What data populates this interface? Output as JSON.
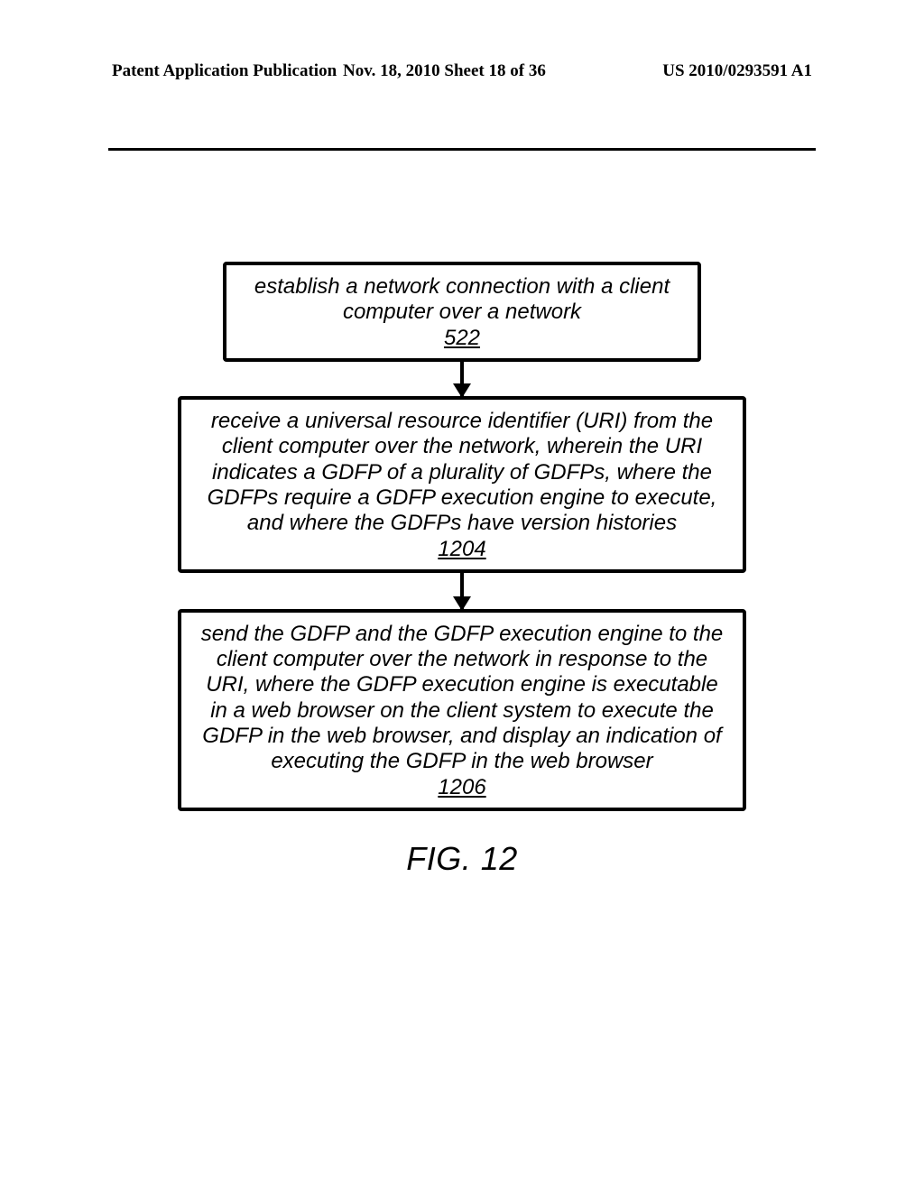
{
  "header": {
    "left": "Patent Application Publication",
    "middle": "Nov. 18, 2010  Sheet 18 of 36",
    "right": "US 2010/0293591 A1"
  },
  "flow": {
    "box1": {
      "text": "establish a network connection with a client computer over a network",
      "ref": "522"
    },
    "box2": {
      "text": "receive a universal resource identifier (URI) from the client computer over the network, wherein the URI indicates a GDFP of a plurality of GDFPs, where the GDFPs require a GDFP execution engine to execute, and where the GDFPs have version histories",
      "ref": "1204"
    },
    "box3": {
      "text": "send the GDFP and the GDFP execution engine to the client computer over the network in response to the URI, where the GDFP execution engine is executable in a web browser on the client system to execute the GDFP in the web browser, and display an indication of executing the GDFP in the web browser",
      "ref": "1206"
    }
  },
  "figure_label": "FIG. 12"
}
